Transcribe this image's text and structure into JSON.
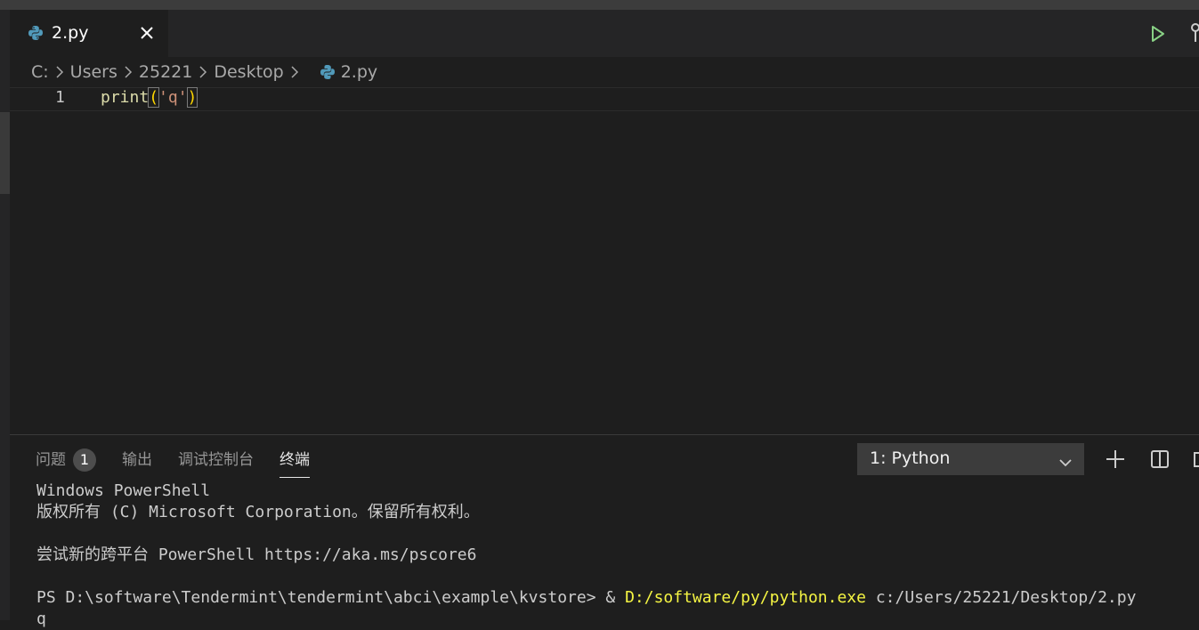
{
  "tab": {
    "filename": "2.py"
  },
  "breadcrumb": {
    "items": [
      "C:",
      "Users",
      "25221",
      "Desktop"
    ],
    "file": "2.py"
  },
  "editor": {
    "line_number": "1",
    "code": {
      "fn": "print",
      "open": "(",
      "str": "'q'",
      "close": ")"
    }
  },
  "panel": {
    "tabs": [
      "问题",
      "输出",
      "调试控制台",
      "终端"
    ],
    "problem_count": "1",
    "terminal_select": "1: Python"
  },
  "terminal": {
    "lines": [
      "Windows PowerShell",
      "版权所有 (C) Microsoft Corporation。保留所有权利。",
      "",
      "尝试新的跨平台 PowerShell https://aka.ms/pscore6",
      ""
    ],
    "prompt": "PS D:\\software\\Tendermint\\tendermint\\abci\\example\\kvstore> & ",
    "exe": "D:/software/py/python.exe",
    "arg": " c:/Users/25221/Desktop/2.py",
    "output": "q"
  },
  "colors": {
    "accent_run": "#89d185",
    "python_blue": "#519aba",
    "python_yellow": "#e2c12f"
  }
}
